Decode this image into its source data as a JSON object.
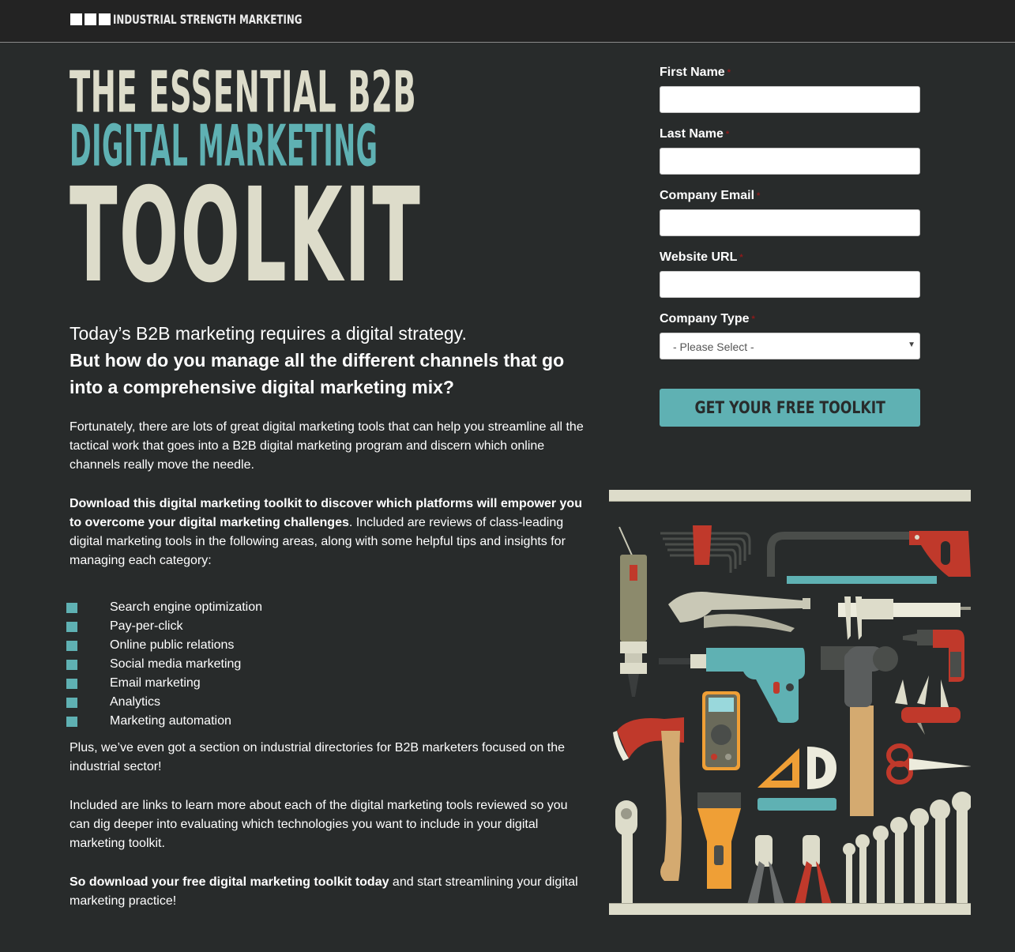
{
  "header": {
    "brand": "INDUSTRIAL STRENGTH MARKETING"
  },
  "headline": {
    "line1": "THE ESSENTIAL B2B",
    "line2": "DIGITAL MARKETING",
    "line3": "TOOLKIT"
  },
  "intro": {
    "lead": "Today’s B2B marketing requires a digital strategy.",
    "question": "But how do you manage all the different channels that go into a comprehensive digital marketing mix?"
  },
  "paragraphs": {
    "p1": "Fortunately, there are lots of great digital marketing tools that can help you streamline all the tactical work that goes into a B2B digital marketing program and discern which online channels really move the needle.",
    "p2_bold": "Download this digital marketing toolkit to discover which platforms will empower you to overcome your digital marketing challenges",
    "p2_rest": ". Included are reviews of class-leading digital marketing tools in the following areas, along with some helpful tips and insights for managing each category:",
    "p3": "Plus, we’ve even got a section on industrial directories for B2B marketers focused on the industrial sector!",
    "p4": "Included are links to learn more about each of the digital marketing tools reviewed so you can dig deeper into evaluating which technologies you want to include in your digital marketing toolkit.",
    "p5_bold": "So download your free digital marketing toolkit today",
    "p5_rest": " and start streamlining your digital marketing practice!"
  },
  "areas": [
    "Search engine optimization",
    "Pay-per-click",
    "Online public relations",
    "Social media marketing",
    "Email marketing",
    "Analytics",
    "Marketing automation"
  ],
  "form": {
    "required_mark": "*",
    "fields": [
      {
        "label": "First Name",
        "value": "",
        "placeholder": ""
      },
      {
        "label": "Last Name",
        "value": "",
        "placeholder": ""
      },
      {
        "label": "Company Email",
        "value": "",
        "placeholder": ""
      },
      {
        "label": "Website URL",
        "value": "",
        "placeholder": ""
      }
    ],
    "company_type": {
      "label": "Company Type",
      "selected": "- Please Select -"
    },
    "submit_label": "GET YOUR FREE TOOLKIT"
  },
  "illustration": {
    "tools": [
      "air-screwdriver",
      "hex-keys",
      "hacksaw",
      "locking-pliers",
      "caliper",
      "cordless-screwdriver",
      "power-drill",
      "hammer",
      "swiss-army-knife",
      "multimeter",
      "axe",
      "set-square",
      "protractor",
      "scissors",
      "ruler",
      "ratchet",
      "flashlight",
      "jumper-clamps",
      "wrench-set"
    ]
  },
  "colors": {
    "background": "#282b2b",
    "accent": "#5fb1b3",
    "cream": "#dddcca",
    "required": "#8f1a1a"
  }
}
